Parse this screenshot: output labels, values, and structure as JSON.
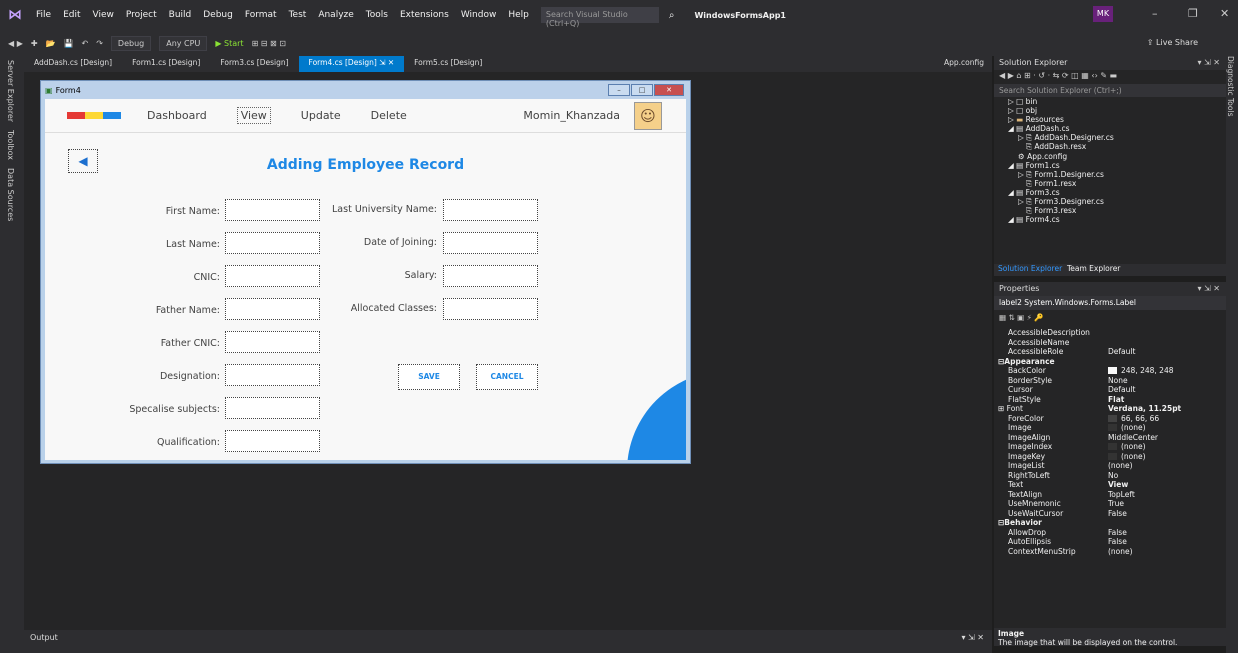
{
  "menubar": {
    "items": [
      "File",
      "Edit",
      "View",
      "Project",
      "Build",
      "Debug",
      "Format",
      "Test",
      "Analyze",
      "Tools",
      "Extensions",
      "Window",
      "Help"
    ],
    "search_placeholder": "Search Visual Studio (Ctrl+Q)",
    "solution_name": "WindowsFormsApp1",
    "user_initials": "MK"
  },
  "toolbar": {
    "config": "Debug",
    "platform": "Any CPU",
    "start_label": "Start",
    "live_share": "Live Share"
  },
  "left_tabs": [
    "Server Explorer",
    "Toolbox",
    "Data Sources"
  ],
  "right_tabs": [
    "Diagnostic Tools"
  ],
  "doc_tabs": [
    {
      "label": "AddDash.cs [Design]"
    },
    {
      "label": "Form1.cs [Design]"
    },
    {
      "label": "Form3.cs [Design]"
    },
    {
      "label": "Form4.cs [Design]"
    },
    {
      "label": "Form5.cs [Design]"
    }
  ],
  "app_config_tab": "App.config",
  "form": {
    "title": "Form4",
    "nav": [
      "Dashboard",
      "View",
      "Update",
      "Delete"
    ],
    "user_name": "Momin_Khanzada",
    "heading": "Adding Employee Record",
    "left_fields": [
      "First Name:",
      "Last Name:",
      "CNIC:",
      "Father Name:",
      "Father CNIC:",
      "Designation:",
      "Specalise subjects:",
      "Qualification:"
    ],
    "right_fields": [
      "Last University Name:",
      "Date of Joining:",
      "Salary:",
      "Allocated Classes:"
    ],
    "save_label": "SAVE",
    "cancel_label": "CANCEL",
    "accent_color": "#1e88e5",
    "logo_colors": [
      "#e53935",
      "#fdd835",
      "#1e88e5"
    ]
  },
  "solution_explorer": {
    "title": "Solution Explorer",
    "search_placeholder": "Search Solution Explorer (Ctrl+;)",
    "tree": [
      {
        "label": "bin",
        "level": 1
      },
      {
        "label": "obj",
        "level": 1
      },
      {
        "label": "Resources",
        "level": 1
      },
      {
        "label": "AddDash.cs",
        "level": 1
      },
      {
        "label": "AddDash.Designer.cs",
        "level": 2
      },
      {
        "label": "AddDash.resx",
        "level": 2
      },
      {
        "label": "App.config",
        "level": 1
      },
      {
        "label": "Form1.cs",
        "level": 1
      },
      {
        "label": "Form1.Designer.cs",
        "level": 2
      },
      {
        "label": "Form1.resx",
        "level": 2
      },
      {
        "label": "Form3.cs",
        "level": 1
      },
      {
        "label": "Form3.Designer.cs",
        "level": 2
      },
      {
        "label": "Form3.resx",
        "level": 2
      },
      {
        "label": "Form4.cs",
        "level": 1
      }
    ],
    "tabs": [
      "Solution Explorer",
      "Team Explorer"
    ]
  },
  "properties": {
    "title": "Properties",
    "object": "label2 System.Windows.Forms.Label",
    "rows": [
      {
        "name": "AccessibleDescription",
        "value": ""
      },
      {
        "name": "AccessibleName",
        "value": ""
      },
      {
        "name": "AccessibleRole",
        "value": "Default"
      },
      {
        "name": "Appearance",
        "value": "",
        "category": true
      },
      {
        "name": "BackColor",
        "value": "248, 248, 248",
        "swatch": "#f8f8f8"
      },
      {
        "name": "BorderStyle",
        "value": "None"
      },
      {
        "name": "Cursor",
        "value": "Default"
      },
      {
        "name": "FlatStyle",
        "value": "Flat"
      },
      {
        "name": "Font",
        "value": "Verdana, 11.25pt",
        "category": true
      },
      {
        "name": "ForeColor",
        "value": "66, 66, 66",
        "swatch": "#424242"
      },
      {
        "name": "Image",
        "value": "(none)",
        "swatch": "#333333"
      },
      {
        "name": "ImageAlign",
        "value": "MiddleCenter"
      },
      {
        "name": "ImageIndex",
        "value": "(none)",
        "swatch": "#333333"
      },
      {
        "name": "ImageKey",
        "value": "(none)",
        "swatch": "#333333"
      },
      {
        "name": "ImageList",
        "value": "(none)"
      },
      {
        "name": "RightToLeft",
        "value": "No"
      },
      {
        "name": "Text",
        "value": "View"
      },
      {
        "name": "TextAlign",
        "value": "TopLeft"
      },
      {
        "name": "UseMnemonic",
        "value": "True"
      },
      {
        "name": "UseWaitCursor",
        "value": "False"
      },
      {
        "name": "Behavior",
        "value": "",
        "category": true
      },
      {
        "name": "AllowDrop",
        "value": "False"
      },
      {
        "name": "AutoEllipsis",
        "value": "False"
      },
      {
        "name": "ContextMenuStrip",
        "value": "(none)"
      }
    ],
    "desc_title": "Image",
    "desc_text": "The image that will be displayed on the control."
  },
  "output": {
    "title": "Output"
  }
}
